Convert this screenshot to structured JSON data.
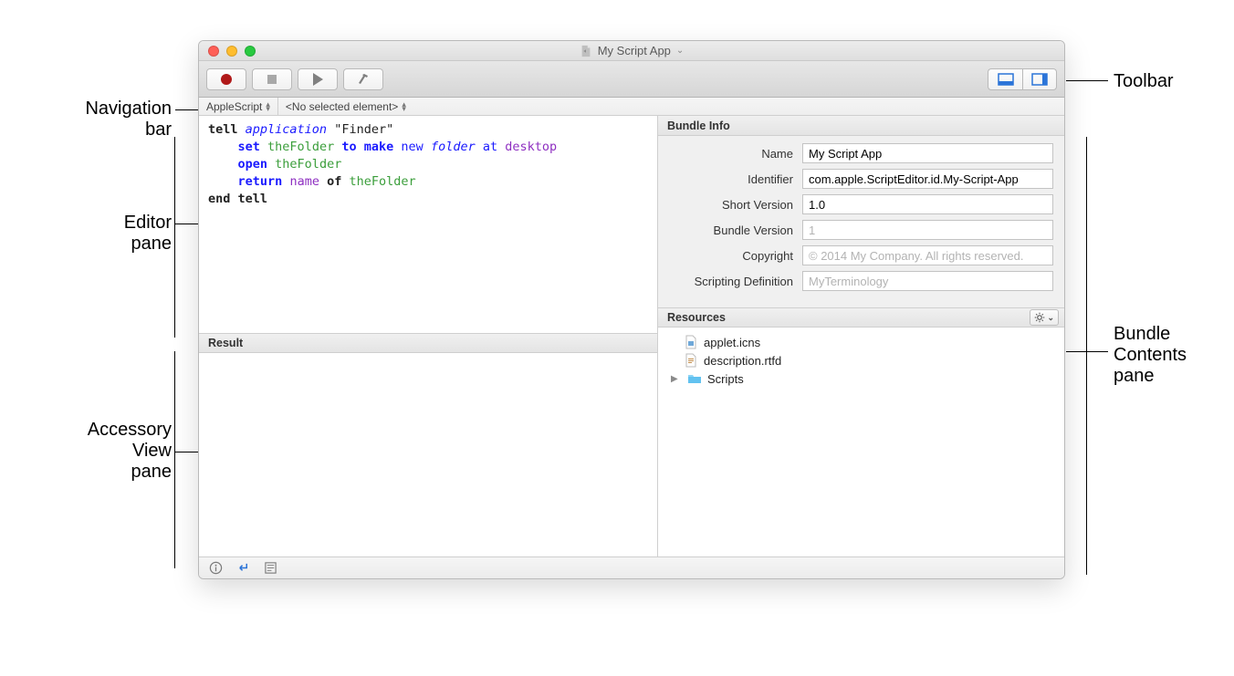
{
  "callouts": {
    "toolbar": "Toolbar",
    "navbar": "Navigation\nbar",
    "editor": "Editor\npane",
    "accessory": "Accessory\nView\npane",
    "bundle": "Bundle\nContents\npane"
  },
  "window": {
    "title": "My Script App"
  },
  "navbar": {
    "lang": "AppleScript",
    "element": "<No selected element>"
  },
  "editor": {
    "line1_tell": "tell",
    "line1_app": "application",
    "line1_str": "\"Finder\"",
    "line2_set": "set",
    "line2_var": "theFolder",
    "line2_to": "to",
    "line2_make": "make",
    "line2_new": "new",
    "line2_cls": "folder",
    "line2_at": "at",
    "line2_enum": "desktop",
    "line3_open": "open",
    "line3_var": "theFolder",
    "line4_return": "return",
    "line4_prop": "name",
    "line4_of": "of",
    "line4_var": "theFolder",
    "line5_end": "end tell"
  },
  "result_header": "Result",
  "bundle": {
    "info_header": "Bundle Info",
    "fields": {
      "name_label": "Name",
      "name_value": "My Script App",
      "identifier_label": "Identifier",
      "identifier_value": "com.apple.ScriptEditor.id.My-Script-App",
      "shortver_label": "Short Version",
      "shortver_value": "1.0",
      "bundlever_label": "Bundle Version",
      "bundlever_placeholder": "1",
      "copyright_label": "Copyright",
      "copyright_placeholder": "© 2014 My Company. All rights reserved.",
      "sdef_label": "Scripting Definition",
      "sdef_placeholder": "MyTerminology"
    },
    "resources_header": "Resources",
    "resources": {
      "file1": "applet.icns",
      "file2": "description.rtfd",
      "folder1": "Scripts"
    }
  }
}
